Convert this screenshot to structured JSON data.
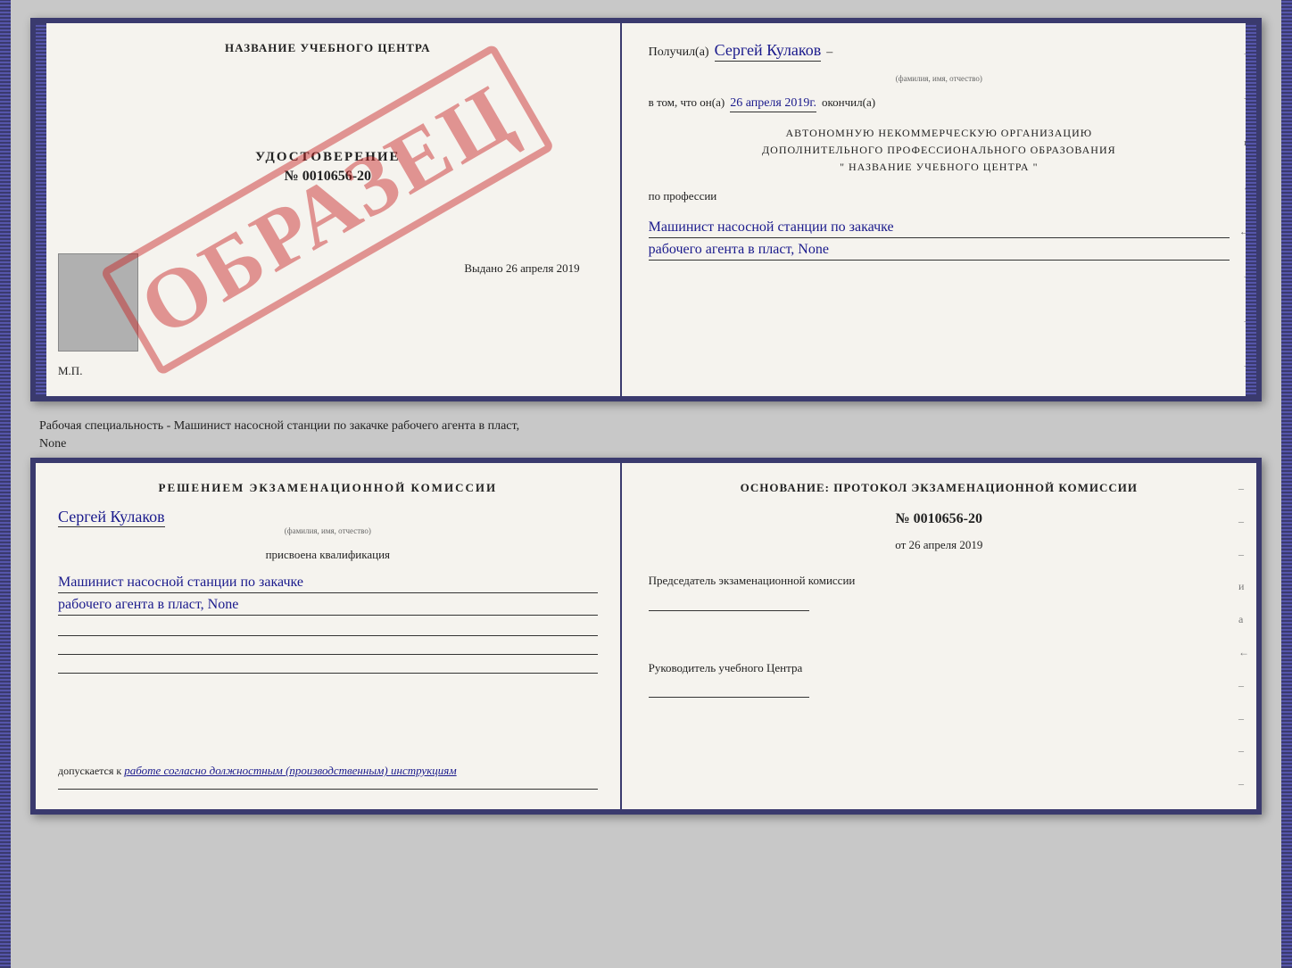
{
  "top_left": {
    "center_title": "НАЗВАНИЕ УЧЕБНОГО ЦЕНТРА",
    "obrazets": "ОБРАЗЕЦ",
    "udostoverenie": "УДОСТОВЕРЕНИЕ",
    "number": "№ 0010656-20",
    "vydano": "Выдано 26 апреля 2019",
    "mp": "М.П."
  },
  "top_right": {
    "poluchil_label": "Получил(a)",
    "poluchil_name": "Сергей Кулаков",
    "familiya_label": "(фамилия, имя, отчество)",
    "dash1": "–",
    "vtom_label": "в том, что он(а)",
    "vtom_date": "26 апреля 2019г.",
    "okonchil_label": "окончил(а)",
    "org_line1": "АВТОНОМНУЮ НЕКОММЕРЧЕСКУЮ ОРГАНИЗАЦИЮ",
    "org_line2": "ДОПОЛНИТЕЛЬНОГО ПРОФЕССИОНАЛЬНОГО ОБРАЗОВАНИЯ",
    "org_line3": "\"  НАЗВАНИЕ УЧЕБНОГО ЦЕНТРА  \"",
    "po_professii": "по профессии",
    "prof1": "Машинист насосной станции по закачке",
    "prof2": "рабочего агента в пласт, None",
    "right_marks": [
      "–",
      "–",
      "и",
      "а",
      "←",
      "–",
      "–",
      "–"
    ]
  },
  "middle": {
    "text1": "Рабочая специальность - Машинист насосной станции по закачке рабочего агента в пласт,",
    "text2": "None"
  },
  "bottom_left": {
    "resheniem": "Решением экзаменационной комиссии",
    "name": "Сергей Кулаков",
    "familiya_label": "(фамилия, имя, отчество)",
    "prisvoena": "присвоена квалификация",
    "kval1": "Машинист насосной станции по закачке",
    "kval2": "рабочего агента в пласт, None",
    "dopusk_label": "допускается к",
    "dopusk_val": "работе согласно должностным (производственным) инструкциям"
  },
  "bottom_right": {
    "osnovanie": "Основание: протокол экзаменационной комиссии",
    "number": "№ 0010656-20",
    "ot_label": "от",
    "ot_date": "26 апреля 2019",
    "predsedatel": "Председатель экзаменационной комиссии",
    "rukovoditel": "Руководитель учебного Центра",
    "right_marks": [
      "–",
      "–",
      "–",
      "и",
      "а",
      "←",
      "–",
      "–",
      "–",
      "–"
    ]
  }
}
